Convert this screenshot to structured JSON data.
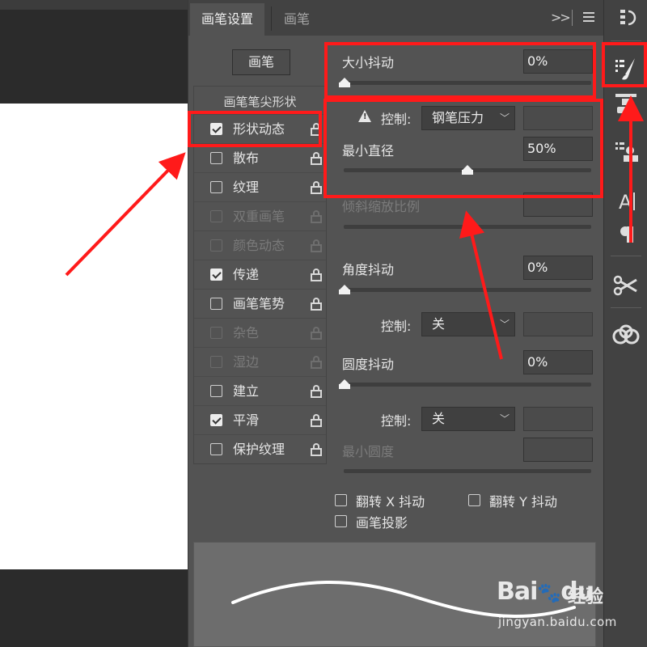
{
  "tabs": [
    {
      "label": "画笔设置",
      "active": true
    },
    {
      "label": "画笔",
      "active": false
    }
  ],
  "header": {
    "collapse_glyph": ">>",
    "menu_icon": "panel-menu-icon"
  },
  "brush_button": "画笔",
  "tip_shape_label": "画笔笔尖形状",
  "options": [
    {
      "label": "形状动态",
      "checked": true,
      "enabled": true
    },
    {
      "label": "散布",
      "checked": false,
      "enabled": true
    },
    {
      "label": "纹理",
      "checked": false,
      "enabled": true
    },
    {
      "label": "双重画笔",
      "checked": false,
      "enabled": false
    },
    {
      "label": "颜色动态",
      "checked": false,
      "enabled": false
    },
    {
      "label": "传递",
      "checked": true,
      "enabled": true
    },
    {
      "label": "画笔笔势",
      "checked": false,
      "enabled": true
    },
    {
      "label": "杂色",
      "checked": false,
      "enabled": false
    },
    {
      "label": "湿边",
      "checked": false,
      "enabled": false
    },
    {
      "label": "建立",
      "checked": false,
      "enabled": true
    },
    {
      "label": "平滑",
      "checked": true,
      "enabled": true
    },
    {
      "label": "保护纹理",
      "checked": false,
      "enabled": true
    }
  ],
  "settings": {
    "size_jitter": {
      "label": "大小抖动",
      "value": "0%",
      "slider_fraction": 0.0
    },
    "size_control": {
      "label": "控制:",
      "value": "钢笔压力"
    },
    "min_diameter": {
      "label": "最小直径",
      "value": "50%",
      "slider_fraction": 0.5
    },
    "tilt_scale": {
      "label": "倾斜缩放比例"
    },
    "angle_jitter": {
      "label": "角度抖动",
      "value": "0%",
      "slider_fraction": 0.0
    },
    "angle_control": {
      "label": "控制:",
      "value": "关"
    },
    "roundness_jitter": {
      "label": "圆度抖动",
      "value": "0%",
      "slider_fraction": 0.0
    },
    "roundness_control": {
      "label": "控制:",
      "value": "关"
    },
    "min_roundness": {
      "label": "最小圆度"
    }
  },
  "bottom_options": {
    "flip_x": "翻转 X 抖动",
    "flip_y": "翻转 Y 抖动",
    "projection": "画笔投影"
  },
  "highlight_color": "#ff1a1a",
  "toolbar_icons": [
    "history-icon",
    "brush-settings-icon",
    "clone-source-icon",
    "tool-presets-icon",
    "character-icon",
    "paragraph-icon",
    "cut-tool-icon",
    "creative-cloud-icon"
  ],
  "watermark": {
    "logo": "Bai",
    "logo_suffix": "du",
    "jingyan": "经验",
    "url": "jingyan.baidu.com"
  }
}
